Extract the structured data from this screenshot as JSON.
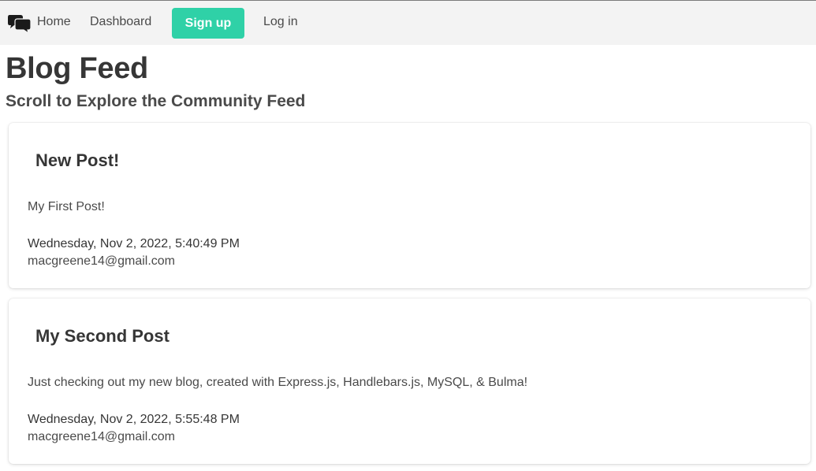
{
  "navbar": {
    "logo_icon": "chat-bubbles-icon",
    "home_label": "Home",
    "dashboard_label": "Dashboard",
    "signup_label": "Sign up",
    "login_label": "Log in",
    "accent_color": "#2fd1a7"
  },
  "header": {
    "title": "Blog Feed",
    "subtitle": "Scroll to Explore the Community Feed"
  },
  "posts": [
    {
      "title": "New Post!",
      "body": "My First Post!",
      "date": "Wednesday, Nov 2, 2022, 5:40:49 PM",
      "author": "macgreene14@gmail.com"
    },
    {
      "title": "My Second Post",
      "body": "Just checking out my new blog, created with Express.js, Handlebars.js, MySQL, & Bulma!",
      "date": "Wednesday, Nov 2, 2022, 5:55:48 PM",
      "author": "macgreene14@gmail.com"
    }
  ]
}
